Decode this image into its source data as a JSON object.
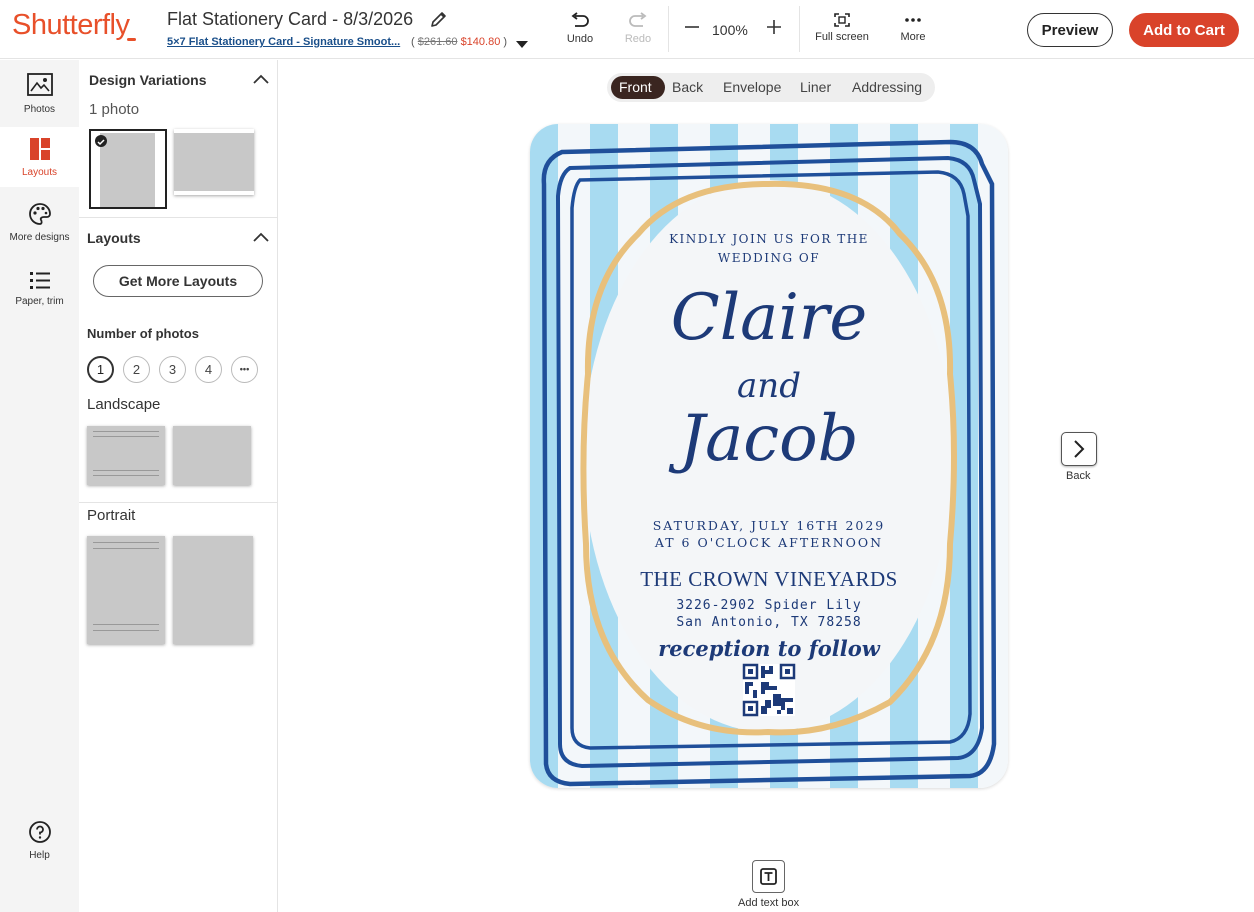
{
  "header": {
    "logo": "Shutterfly",
    "project_title": "Flat Stationery Card - 8/3/2026",
    "product_link": "5×7 Flat Stationery Card - Signature Smoot...",
    "price_open": "(",
    "price_old": "$261.60",
    "price_new": "$140.80",
    "price_close": ")",
    "undo": "Undo",
    "redo": "Redo",
    "zoom": "100%",
    "fullscreen": "Full screen",
    "more": "More",
    "preview": "Preview",
    "add_to_cart": "Add to Cart"
  },
  "rail": {
    "photos": "Photos",
    "layouts": "Layouts",
    "more_designs": "More designs",
    "paper_trim": "Paper, trim",
    "help": "Help"
  },
  "panel": {
    "design_variations": "Design Variations",
    "one_photo": "1 photo",
    "layouts_title": "Layouts",
    "get_more_layouts": "Get More Layouts",
    "number_of_photos": "Number of photos",
    "counts": [
      "1",
      "2",
      "3",
      "4",
      "•••"
    ],
    "landscape": "Landscape",
    "portrait": "Portrait"
  },
  "tabs": [
    "Front",
    "Back",
    "Envelope",
    "Liner",
    "Addressing"
  ],
  "card": {
    "invite_line1": "KINDLY JOIN US FOR THE",
    "invite_line2": "WEDDING OF",
    "name1": "Claire",
    "and": "and",
    "name2": "Jacob",
    "date": "SATURDAY, JULY 16TH 2029",
    "time": "AT 6 O'CLOCK AFTERNOON",
    "venue": "THE CROWN VINEYARDS",
    "address1": "3226-2902 Spider Lily",
    "address2": "San Antonio, TX 78258",
    "reception": "reception to follow"
  },
  "canvas": {
    "next_label": "Back",
    "add_text_box": "Add text box"
  },
  "colors": {
    "brand": "#e8502a",
    "cart": "#d9432a",
    "navy": "#1d3a78",
    "stripe": "#a8dbf1",
    "gold": "#e8c07c"
  }
}
